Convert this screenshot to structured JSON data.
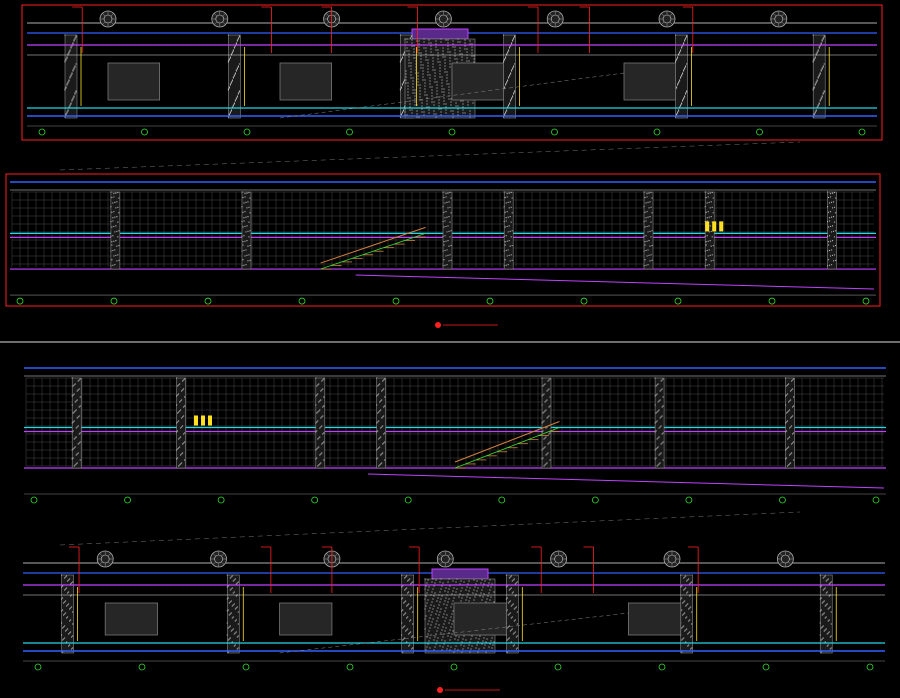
{
  "drawing": {
    "background": "#000000",
    "colors": {
      "red": "#ff2020",
      "green": "#33dd33",
      "cyan": "#22d8e8",
      "blue": "#3060ff",
      "magenta": "#c040ff",
      "white": "#e8e8e8",
      "gray": "#8a8a8a",
      "yellow": "#ffe020",
      "orange": "#d08040"
    },
    "panels": [
      {
        "id": "elevation-a",
        "kind": "long-elevation",
        "frame_color": "red"
      },
      {
        "id": "section-b",
        "kind": "section-with-stair",
        "frame_color": "red",
        "stair": "right"
      },
      {
        "id": "section-c",
        "kind": "section-with-stair",
        "frame_color": "none",
        "stair": "left"
      },
      {
        "id": "elevation-d",
        "kind": "long-elevation",
        "frame_color": "none"
      }
    ],
    "title_marks": [
      {
        "panel": "section-b",
        "symbol": "section-title-marker"
      },
      {
        "panel": "elevation-d",
        "symbol": "section-title-marker"
      }
    ],
    "icons": {
      "grid_axis_bubble": "circle-marker",
      "title_marker": "red-circle-marker",
      "decorative_rosette": "ornament-rosette"
    }
  }
}
